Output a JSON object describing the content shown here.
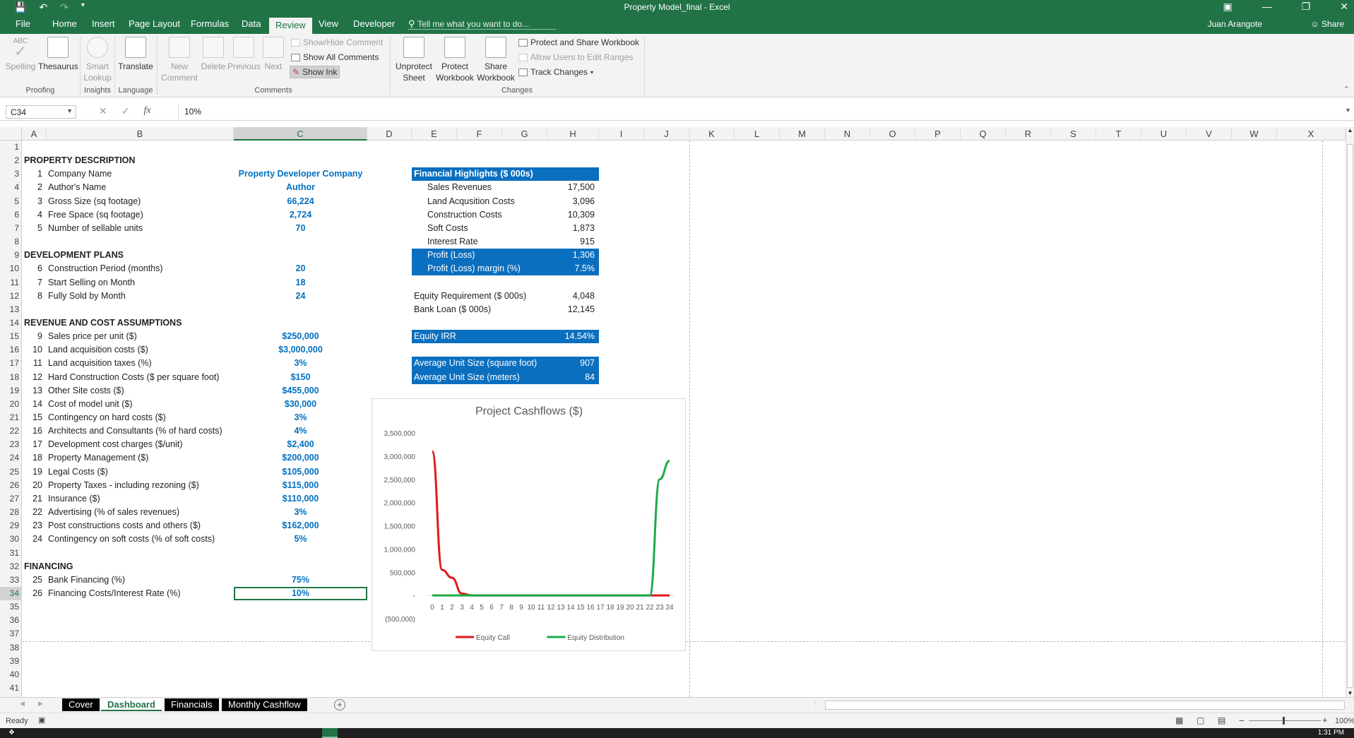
{
  "window": {
    "title": "Property Model_final - Excel"
  },
  "tabs": {
    "file": "File",
    "home": "Home",
    "insert": "Insert",
    "page_layout": "Page Layout",
    "formulas": "Formulas",
    "data": "Data",
    "review": "Review",
    "view": "View",
    "developer": "Developer"
  },
  "tellme": "Tell me what you want to do...",
  "user": "Juan Arangote",
  "share": "Share",
  "ribbon": {
    "spelling_abc": "ABC",
    "spelling": "Spelling",
    "thesaurus": "Thesaurus",
    "smart1": "Smart",
    "smart2": "Lookup",
    "translate": "Translate",
    "new1": "New",
    "new2": "Comment",
    "delete": "Delete",
    "previous": "Previous",
    "next": "Next",
    "show_hide": "Show/Hide Comment",
    "show_all": "Show All Comments",
    "show_ink": "Show Ink",
    "unprot1": "Unprotect",
    "unprot2": "Sheet",
    "protwb1": "Protect",
    "protwb2": "Workbook",
    "sharewb1": "Share",
    "sharewb2": "Workbook",
    "protect_share": "Protect and Share Workbook",
    "allow_users": "Allow Users to Edit Ranges",
    "track": "Track Changes",
    "g_proofing": "Proofing",
    "g_insights": "Insights",
    "g_language": "Language",
    "g_comments": "Comments",
    "g_changes": "Changes"
  },
  "formula_bar": {
    "name_box": "C34",
    "value": "10%"
  },
  "columns": [
    "A",
    "B",
    "C",
    "D",
    "E",
    "F",
    "G",
    "H",
    "I",
    "J",
    "K",
    "L",
    "M",
    "N",
    "O",
    "P",
    "Q",
    "R",
    "S",
    "T",
    "U",
    "V",
    "W",
    "X"
  ],
  "rows": [
    "1",
    "2",
    "3",
    "4",
    "5",
    "6",
    "7",
    "8",
    "9",
    "10",
    "11",
    "12",
    "13",
    "14",
    "15",
    "16",
    "17",
    "18",
    "19",
    "20",
    "21",
    "22",
    "23",
    "24",
    "25",
    "26",
    "27",
    "28",
    "29",
    "30",
    "31",
    "32",
    "33",
    "34",
    "35",
    "36",
    "37",
    "38",
    "39",
    "40",
    "41"
  ],
  "sections": {
    "property": "PROPERTY DESCRIPTION",
    "development": "DEVELOPMENT PLANS",
    "revenue": "REVENUE AND COST ASSUMPTIONS",
    "financing": "FINANCING"
  },
  "inputs": [
    {
      "row": 3,
      "n": "1",
      "label": "Company Name",
      "value": "Property Developer Company"
    },
    {
      "row": 4,
      "n": "2",
      "label": "Author's Name",
      "value": "Author"
    },
    {
      "row": 5,
      "n": "3",
      "label": "Gross Size (sq footage)",
      "value": "66,224"
    },
    {
      "row": 6,
      "n": "4",
      "label": "Free Space (sq footage)",
      "value": "2,724"
    },
    {
      "row": 7,
      "n": "5",
      "label": "Number of sellable units",
      "value": "70"
    },
    {
      "row": 10,
      "n": "6",
      "label": "Construction Period (months)",
      "value": "20"
    },
    {
      "row": 11,
      "n": "7",
      "label": "Start Selling on Month",
      "value": "18"
    },
    {
      "row": 12,
      "n": "8",
      "label": "Fully Sold by Month",
      "value": "24"
    },
    {
      "row": 15,
      "n": "9",
      "label": "Sales price per unit ($)",
      "value": "$250,000"
    },
    {
      "row": 16,
      "n": "10",
      "label": "Land acquisition costs ($)",
      "value": "$3,000,000"
    },
    {
      "row": 17,
      "n": "11",
      "label": "Land acquisition taxes (%)",
      "value": "3%"
    },
    {
      "row": 18,
      "n": "12",
      "label": "Hard Construction Costs ($ per square foot)",
      "value": "$150"
    },
    {
      "row": 19,
      "n": "13",
      "label": "Other Site costs ($)",
      "value": "$455,000"
    },
    {
      "row": 20,
      "n": "14",
      "label": "Cost of model unit ($)",
      "value": "$30,000"
    },
    {
      "row": 21,
      "n": "15",
      "label": "Contingency on hard costs ($)",
      "value": "3%"
    },
    {
      "row": 22,
      "n": "16",
      "label": "Architects and Consultants (% of hard costs)",
      "value": "4%"
    },
    {
      "row": 23,
      "n": "17",
      "label": "Development cost charges ($/unit)",
      "value": "$2,400"
    },
    {
      "row": 24,
      "n": "18",
      "label": "Property Management ($)",
      "value": "$200,000"
    },
    {
      "row": 25,
      "n": "19",
      "label": "Legal Costs ($)",
      "value": "$105,000"
    },
    {
      "row": 26,
      "n": "20",
      "label": "Property Taxes - including rezoning ($)",
      "value": "$115,000"
    },
    {
      "row": 27,
      "n": "21",
      "label": "Insurance ($)",
      "value": "$110,000"
    },
    {
      "row": 28,
      "n": "22",
      "label": "Advertising (% of sales revenues)",
      "value": "3%"
    },
    {
      "row": 29,
      "n": "23",
      "label": "Post constructions costs and others ($)",
      "value": "$162,000"
    },
    {
      "row": 30,
      "n": "24",
      "label": "Contingency on soft costs (% of soft costs)",
      "value": "5%"
    },
    {
      "row": 33,
      "n": "25",
      "label": "Bank Financing (%)",
      "value": "75%"
    },
    {
      "row": 34,
      "n": "26",
      "label": "Financing Costs/Interest Rate (%)",
      "value": "10%"
    }
  ],
  "highlights": {
    "title": "Financial Highlights ($ 000s)",
    "items": [
      {
        "row": 4,
        "label": "Sales Revenues",
        "value": "17,500"
      },
      {
        "row": 5,
        "label": "Land Acqusition Costs",
        "value": "3,096"
      },
      {
        "row": 6,
        "label": "Construction Costs",
        "value": "10,309"
      },
      {
        "row": 7,
        "label": "Soft Costs",
        "value": "1,873"
      },
      {
        "row": 8,
        "label": "Interest Rate",
        "value": "915"
      }
    ],
    "profit": {
      "label": "Profit (Loss)",
      "value": "1,306"
    },
    "margin": {
      "label": "Profit (Loss) margin (%)",
      "value": "7.5%"
    },
    "equity_req": {
      "label": "Equity Requirement ($ 000s)",
      "value": "4,048"
    },
    "bank_loan": {
      "label": "Bank Loan ($ 000s)",
      "value": "12,145"
    },
    "irr": {
      "label": "Equity IRR",
      "value": "14.54%"
    },
    "avg_sqft": {
      "label": "Average Unit Size (square foot)",
      "value": "907"
    },
    "avg_m": {
      "label": "Average Unit Size (meters)",
      "value": "84"
    }
  },
  "chart_data": {
    "type": "line",
    "title": "Project Cashflows ($)",
    "x": [
      0,
      1,
      2,
      3,
      4,
      5,
      6,
      7,
      8,
      9,
      10,
      11,
      12,
      13,
      14,
      15,
      16,
      17,
      18,
      19,
      20,
      21,
      22,
      23,
      24
    ],
    "y_ticks": [
      "3,500,000",
      "3,000,000",
      "2,500,000",
      "2,000,000",
      "1,500,000",
      "1,000,000",
      "500,000",
      "-",
      "(500,000)"
    ],
    "ylim": [
      -500000,
      3500000
    ],
    "series": [
      {
        "name": "Equity Call",
        "color": "#e0191b",
        "values": [
          3100000,
          550000,
          380000,
          40000,
          0,
          0,
          0,
          0,
          0,
          0,
          0,
          0,
          0,
          0,
          0,
          0,
          0,
          0,
          0,
          0,
          0,
          0,
          0,
          0,
          0
        ]
      },
      {
        "name": "Equity Distribution",
        "color": "#1daa4a",
        "values": [
          0,
          0,
          0,
          0,
          0,
          0,
          0,
          0,
          0,
          0,
          0,
          0,
          0,
          0,
          0,
          0,
          0,
          0,
          0,
          0,
          0,
          0,
          0,
          2500000,
          2900000
        ]
      }
    ],
    "legend": "bottom"
  },
  "sheet_tabs": [
    "Cover",
    "Dashboard",
    "Financials",
    "Monthly Cashflow"
  ],
  "status": {
    "ready": "Ready",
    "zoom": "100%"
  },
  "taskbar": {
    "time": "1:31 PM"
  }
}
